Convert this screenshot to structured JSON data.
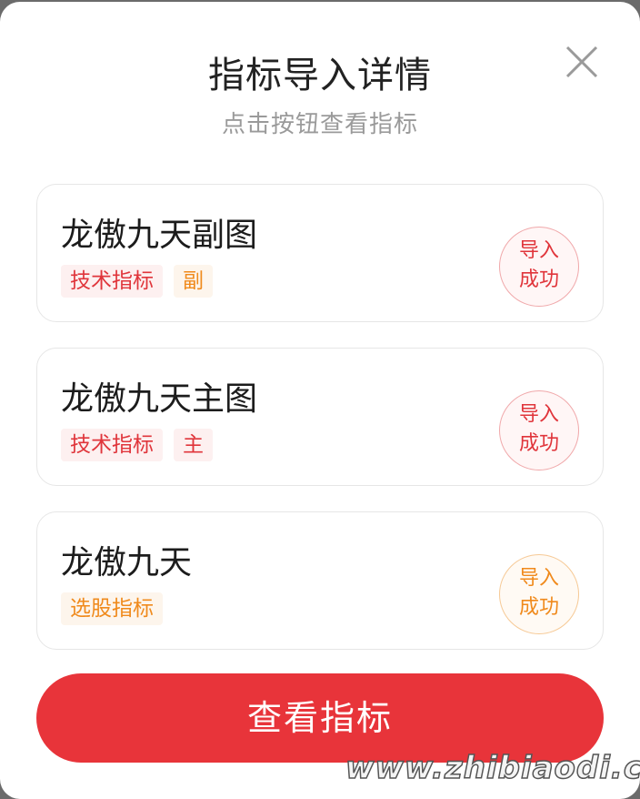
{
  "dialog": {
    "title": "指标导入详情",
    "subtitle": "点击按钮查看指标",
    "close_icon": "close-icon"
  },
  "indicators": [
    {
      "name": "龙傲九天副图",
      "tags": [
        {
          "label": "技术指标",
          "color": "#e0353b"
        },
        {
          "label": "副",
          "color": "#f08a1c"
        }
      ],
      "status_line1": "导入",
      "status_line2": "成功",
      "status_color": "#e0353b"
    },
    {
      "name": "龙傲九天主图",
      "tags": [
        {
          "label": "技术指标",
          "color": "#e0353b"
        },
        {
          "label": "主",
          "color": "#e0353b"
        }
      ],
      "status_line1": "导入",
      "status_line2": "成功",
      "status_color": "#e0353b"
    },
    {
      "name": "龙傲九天",
      "tags": [
        {
          "label": "选股指标",
          "color": "#f08a1c"
        }
      ],
      "status_line1": "导入",
      "status_line2": "成功",
      "status_color": "#f08a1c"
    }
  ],
  "actions": {
    "view_button_label": "查看指标",
    "button_color": "#e8343a"
  },
  "watermark": {
    "text": "www.zhibiaodi.com"
  }
}
